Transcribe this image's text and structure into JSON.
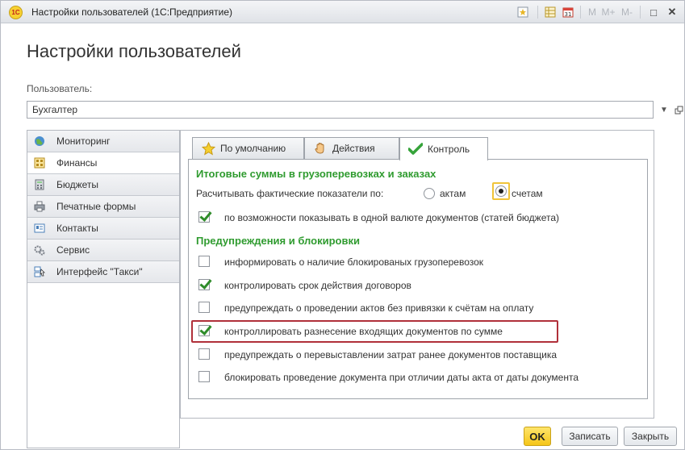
{
  "window": {
    "title": "Настройки пользователей  (1С:Предприятие)",
    "logo_text": "1С",
    "toolbar": {
      "m": "M",
      "m_plus": "M+",
      "m_minus": "M-",
      "restore": "□",
      "close": "✕"
    }
  },
  "form": {
    "heading": "Настройки пользователей",
    "user_label": "Пользователь:",
    "user_value": "Бухгалтер"
  },
  "sidebar": {
    "items": [
      {
        "label": "Мониторинг",
        "icon": "globe-icon"
      },
      {
        "label": "Финансы",
        "icon": "finance-icon"
      },
      {
        "label": "Бюджеты",
        "icon": "calculator-icon"
      },
      {
        "label": "Печатные формы",
        "icon": "printer-icon"
      },
      {
        "label": "Контакты",
        "icon": "contact-card-icon"
      },
      {
        "label": "Сервис",
        "icon": "gears-icon"
      },
      {
        "label": "Интерфейс \"Такси\"",
        "icon": "interface-icon"
      }
    ],
    "active_index": 1
  },
  "tabs": [
    {
      "label": "По умолчанию",
      "icon": "star-icon"
    },
    {
      "label": "Действия",
      "icon": "hand-icon"
    },
    {
      "label": "Контроль",
      "icon": "check-icon"
    }
  ],
  "active_tab": 2,
  "control": {
    "section1_title": "Итоговые суммы в грузоперевозках и заказах",
    "calc_label": "Расчитывать фактические показатели по:",
    "radio_acts": "актам",
    "radio_invoices": "счетам",
    "radio_selected": "счетам",
    "single_currency": {
      "label": "по возможности показывать в одной валюте документов (статей бюджета)",
      "checked": true
    },
    "section2_title": "Предупреждения и блокировки",
    "options": [
      {
        "label": "информировать о наличие блокированых грузоперевозок",
        "checked": false
      },
      {
        "label": "контролировать срок действия договоров",
        "checked": true
      },
      {
        "label": "предупреждать о проведении актов без привязки к счётам на оплату",
        "checked": false
      },
      {
        "label": "контроллировать разнесение входящих документов по сумме",
        "checked": true
      },
      {
        "label": "предупреждать о перевыставлении затрат ранее документов поставщика",
        "checked": false
      },
      {
        "label": "блокировать проведение документа при отличии даты акта от даты документа",
        "checked": false
      }
    ]
  },
  "buttons": {
    "ok": "OK",
    "save": "Записать",
    "close": "Закрыть"
  },
  "colors": {
    "section_title": "#2f9b2f",
    "highlight_border": "#b0303a",
    "ok_button": "#f5c518"
  }
}
